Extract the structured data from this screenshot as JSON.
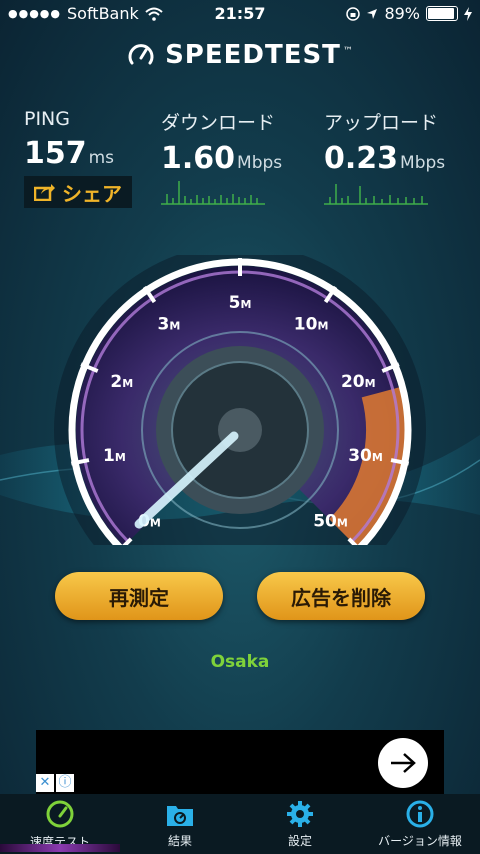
{
  "status_bar": {
    "carrier": "SoftBank",
    "time": "21:57",
    "battery": "89%"
  },
  "brand": {
    "name": "SPEEDTEST",
    "tm": "™"
  },
  "stats": {
    "ping": {
      "label": "PING",
      "value": "157",
      "unit": "ms"
    },
    "download": {
      "label": "ダウンロード",
      "value": "1.60",
      "unit": "Mbps"
    },
    "upload": {
      "label": "アップロード",
      "value": "0.23",
      "unit": "Mbps"
    }
  },
  "share_label": "シェア",
  "gauge": {
    "ticks": [
      {
        "num": "0",
        "suf": "M"
      },
      {
        "num": "1",
        "suf": "M"
      },
      {
        "num": "2",
        "suf": "M"
      },
      {
        "num": "3",
        "suf": "M"
      },
      {
        "num": "5",
        "suf": "M"
      },
      {
        "num": "10",
        "suf": "M"
      },
      {
        "num": "20",
        "suf": "M"
      },
      {
        "num": "30",
        "suf": "M"
      },
      {
        "num": "50",
        "suf": "M"
      }
    ],
    "needle_value": "0"
  },
  "buttons": {
    "retest": "再測定",
    "remove_ads": "広告を削除"
  },
  "server": "Osaka",
  "tabs": [
    {
      "label": "速度テスト",
      "icon": "speedometer-icon"
    },
    {
      "label": "結果",
      "icon": "results-folder-icon"
    },
    {
      "label": "設定",
      "icon": "gear-icon"
    },
    {
      "label": "バージョン情報",
      "icon": "info-icon"
    }
  ],
  "colors": {
    "accent": "#f0b429",
    "server": "#7fd23a",
    "tab_icon": "#2ab0e8"
  }
}
